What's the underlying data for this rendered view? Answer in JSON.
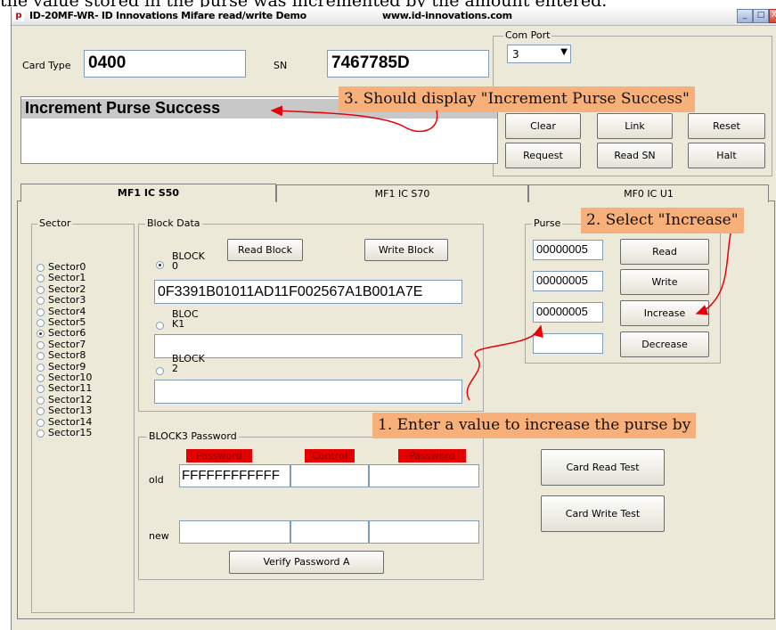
{
  "caption": "the value stored in the purse was incremented by the amount entered.",
  "window": {
    "icon_text": "p",
    "title": "ID-20MF-WR- ID Innovations Mifare read/write Demo",
    "url": "www.id-innovations.com",
    "minimize": "_",
    "maximize": "□",
    "close": "X"
  },
  "card_type_label": "Card Type",
  "card_type_value": "0400",
  "sn_label": "SN",
  "sn_value": "7467785D",
  "com_port": {
    "label": "Com Port",
    "value": "3",
    "arrow": "▼"
  },
  "status_message": "Increment Purse Success",
  "buttons": {
    "clear": "Clear",
    "link": "Link",
    "reset": "Reset",
    "request": "Request",
    "read_sn": "Read SN",
    "halt": "Halt"
  },
  "tabs": [
    "MF1 IC S50",
    "MF1 IC S70",
    "MF0 IC U1"
  ],
  "sector": {
    "title": "Sector",
    "items": [
      "Sector0",
      "Sector1",
      "Sector2",
      "Sector3",
      "Sector4",
      "Sector5",
      "Sector6",
      "Sector7",
      "Sector8",
      "Sector9",
      "Sector10",
      "Sector11",
      "Sector12",
      "Sector13",
      "Sector14",
      "Sector15"
    ],
    "selected": "Sector6"
  },
  "block_data": {
    "title": "Block Data",
    "read_block": "Read Block",
    "write_block": "Write Block",
    "block0_label": "BLOCK\n0",
    "block0_value": "0F3391B01011AD11F002567A1B001A7E",
    "block1_label": "BLOC\nK1",
    "block1_value": "",
    "block2_label": "BLOCK\n2",
    "block2_value": ""
  },
  "password": {
    "title": "BLOCK3 Password",
    "col_password_a": "Password",
    "col_control": "Control",
    "col_password_b": "Password",
    "old_label": "old",
    "old_a": "FFFFFFFFFFFF",
    "new_label": "new",
    "verify": "Verify Password A"
  },
  "purse": {
    "title": "Purse",
    "read_value": "00000005",
    "write_value": "00000005",
    "increase_value": "00000005",
    "decrease_value": "",
    "read": "Read",
    "write": "Write",
    "increase": "Increase",
    "decrease": "Decrease"
  },
  "card_read_test": "Card Read Test",
  "card_write_test": "Card Write Test",
  "annotations": {
    "step1": "1. Enter a value to increase the purse by",
    "step2": "2. Select \"Increase\"",
    "step3": "3. Should display \"Increment Purse Success\""
  },
  "colors": {
    "window_bg": "#ece9d8",
    "callout_bg": "#f7b07a",
    "arrow": "#e8000a",
    "red_header": "#e50000"
  }
}
